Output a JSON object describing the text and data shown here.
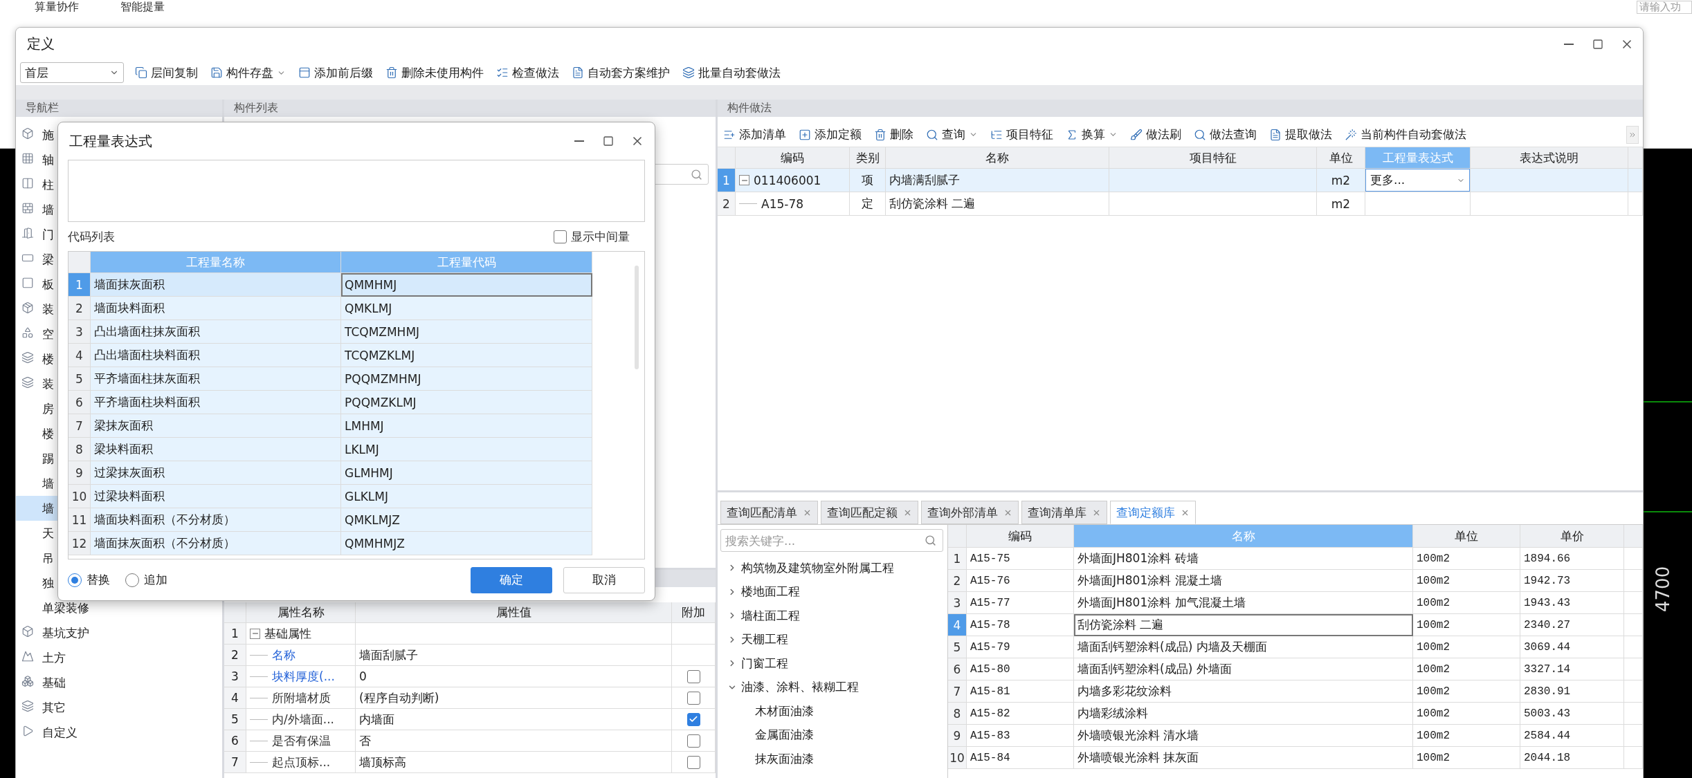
{
  "app": {
    "menu": [
      {
        "label": "算量协作"
      },
      {
        "label": "智能提量"
      }
    ],
    "search": {
      "placeholder": "请输入功"
    },
    "canvas_label": "4700"
  },
  "window": {
    "title": "定义",
    "floor": "首层",
    "toolbar": [
      {
        "label": "层间复制",
        "dropdown": false
      },
      {
        "label": "构件存盘",
        "dropdown": true
      },
      {
        "label": "添加前后缀",
        "dropdown": false
      },
      {
        "label": "删除未使用构件",
        "dropdown": false
      },
      {
        "label": "检查做法",
        "dropdown": false
      },
      {
        "label": "自动套方案维护",
        "dropdown": false
      },
      {
        "label": "批量自动套做法",
        "dropdown": false
      }
    ]
  },
  "nav": {
    "title": "导航栏",
    "items": [
      {
        "label": "施",
        "selected": false
      },
      {
        "label": "轴",
        "selected": false
      },
      {
        "label": "柱",
        "selected": false
      },
      {
        "label": "墙",
        "selected": false
      },
      {
        "label": "门",
        "selected": false
      },
      {
        "label": "梁",
        "selected": false
      },
      {
        "label": "板",
        "selected": false
      },
      {
        "label": "装",
        "selected": false
      },
      {
        "label": "空",
        "selected": false
      },
      {
        "label": "楼",
        "selected": false
      },
      {
        "label": "装",
        "selected": false,
        "children": [
          {
            "label": "房",
            "selected": false
          },
          {
            "label": "楼",
            "selected": false
          },
          {
            "label": "踢",
            "selected": false
          },
          {
            "label": "墙",
            "selected": false
          },
          {
            "label": "墙",
            "selected": true
          },
          {
            "label": "天",
            "selected": false
          },
          {
            "label": "吊",
            "selected": false
          },
          {
            "label": "独",
            "selected": false
          },
          {
            "label": "单梁装修",
            "selected": false
          }
        ]
      },
      {
        "label": "基坑支护",
        "selected": false
      },
      {
        "label": "土方",
        "selected": false
      },
      {
        "label": "基础",
        "selected": false
      },
      {
        "label": "其它",
        "selected": false
      },
      {
        "label": "自定义",
        "selected": false
      }
    ]
  },
  "component_list": {
    "title": "构件列表"
  },
  "properties": {
    "columns": [
      "属性名称",
      "属性值",
      "附加"
    ],
    "rows": [
      {
        "num": "1",
        "kind": "group",
        "name": "基础属性",
        "expanded": true
      },
      {
        "num": "2",
        "kind": "field",
        "name": "名称",
        "value": "墙面刮腻子",
        "public": true
      },
      {
        "num": "3",
        "kind": "option",
        "name": "块料厚度(...",
        "value": "0",
        "public": true,
        "checked": false
      },
      {
        "num": "4",
        "kind": "option",
        "name": "所附墙材质",
        "value": "(程序自动判断)",
        "public": false,
        "checked": false
      },
      {
        "num": "5",
        "kind": "option",
        "name": "内/外墙面...",
        "value": "内墙面",
        "public": false,
        "checked": true
      },
      {
        "num": "6",
        "kind": "option",
        "name": "是否有保温",
        "value": "否",
        "public": false,
        "checked": false
      },
      {
        "num": "7",
        "kind": "option",
        "name": "起点顶标...",
        "value": "墙顶标高",
        "public": false,
        "checked": false
      }
    ]
  },
  "methods": {
    "title": "构件做法",
    "toolbar": [
      {
        "label": "添加清单",
        "dropdown": false
      },
      {
        "label": "添加定额",
        "dropdown": false
      },
      {
        "label": "删除",
        "dropdown": false
      },
      {
        "label": "查询",
        "dropdown": true
      },
      {
        "label": "项目特征",
        "dropdown": false
      },
      {
        "label": "换算",
        "dropdown": true
      },
      {
        "label": "做法刷",
        "dropdown": false
      },
      {
        "label": "做法查询",
        "dropdown": false
      },
      {
        "label": "提取做法",
        "dropdown": false
      },
      {
        "label": "当前构件自动套做法",
        "dropdown": false
      }
    ],
    "columns": [
      {
        "label": "编码",
        "selected": false
      },
      {
        "label": "类别",
        "selected": false
      },
      {
        "label": "名称",
        "selected": false
      },
      {
        "label": "项目特征",
        "selected": false
      },
      {
        "label": "单位",
        "selected": false
      },
      {
        "label": "工程量表达式",
        "selected": true
      },
      {
        "label": "表达式说明",
        "selected": false
      }
    ],
    "rows": [
      {
        "num": "1",
        "code": "011406001",
        "type": "项",
        "name": "内墙满刮腻子",
        "unit": "m2",
        "expression": "更多...",
        "selected": true,
        "expanded": true,
        "children": [
          {
            "num": "2",
            "code": "A15-78",
            "type": "定",
            "name": "刮仿瓷涂料 二遍",
            "unit": "m2",
            "selected": false
          }
        ]
      }
    ]
  },
  "query": {
    "tabs": [
      {
        "label": "查询匹配清单",
        "selected": false
      },
      {
        "label": "查询匹配定额",
        "selected": false
      },
      {
        "label": "查询外部清单",
        "selected": false
      },
      {
        "label": "查询清单库",
        "selected": false
      },
      {
        "label": "查询定额库",
        "selected": true
      }
    ],
    "search": {
      "placeholder": "搜索关键字..."
    },
    "tree": [
      {
        "label": "构筑物及建筑物室外附属工程",
        "expanded": false
      },
      {
        "label": "楼地面工程",
        "expanded": false
      },
      {
        "label": "墙柱面工程",
        "expanded": false
      },
      {
        "label": "天棚工程",
        "expanded": false
      },
      {
        "label": "门窗工程",
        "expanded": false
      },
      {
        "label": "油漆、涂料、裱糊工程",
        "expanded": true,
        "children": [
          {
            "label": "木材面油漆"
          },
          {
            "label": "金属面油漆"
          },
          {
            "label": "抹灰面油漆"
          }
        ]
      }
    ],
    "columns": [
      {
        "label": "编码",
        "selected": false
      },
      {
        "label": "名称",
        "selected": true
      },
      {
        "label": "单位",
        "selected": false
      },
      {
        "label": "单价",
        "selected": false
      }
    ],
    "rows": [
      {
        "num": "1",
        "code": "A15-75",
        "name": "外墙面JH801涂料 砖墙",
        "unit": "100m2",
        "price": "1894.66",
        "selected": false
      },
      {
        "num": "2",
        "code": "A15-76",
        "name": "外墙面JH801涂料 混凝土墙",
        "unit": "100m2",
        "price": "1942.73",
        "selected": false
      },
      {
        "num": "3",
        "code": "A15-77",
        "name": "外墙面JH801涂料 加气混凝土墙",
        "unit": "100m2",
        "price": "1943.43",
        "selected": false
      },
      {
        "num": "4",
        "code": "A15-78",
        "name": "刮仿瓷涂料 二遍",
        "unit": "100m2",
        "price": "2340.27",
        "selected": true
      },
      {
        "num": "5",
        "code": "A15-79",
        "name": "墙面刮钙塑涂料(成品) 内墙及天棚面",
        "unit": "100m2",
        "price": "3069.44",
        "selected": false
      },
      {
        "num": "6",
        "code": "A15-80",
        "name": "墙面刮钙塑涂料(成品) 外墙面",
        "unit": "100m2",
        "price": "3327.14",
        "selected": false
      },
      {
        "num": "7",
        "code": "A15-81",
        "name": "内墙多彩花纹涂料",
        "unit": "100m2",
        "price": "2830.91",
        "selected": false
      },
      {
        "num": "8",
        "code": "A15-82",
        "name": "内墙彩绒涂料",
        "unit": "100m2",
        "price": "5003.43",
        "selected": false
      },
      {
        "num": "9",
        "code": "A15-83",
        "name": "外墙喷银光涂料 清水墙",
        "unit": "100m2",
        "price": "2584.44",
        "selected": false
      },
      {
        "num": "10",
        "code": "A15-84",
        "name": "外墙喷银光涂料 抹灰面",
        "unit": "100m2",
        "price": "2044.18",
        "selected": false
      }
    ]
  },
  "dialog": {
    "title": "工程量表达式",
    "code_list_label": "代码列表",
    "show_intermediate": {
      "label": "显示中间量",
      "checked": false
    },
    "columns": [
      "工程量名称",
      "工程量代码"
    ],
    "rows": [
      {
        "num": "1",
        "name": "墙面抹灰面积",
        "code": "QMMHMJ",
        "selected": true
      },
      {
        "num": "2",
        "name": "墙面块料面积",
        "code": "QMKLMJ",
        "selected": false
      },
      {
        "num": "3",
        "name": "凸出墙面柱抹灰面积",
        "code": "TCQMZMHMJ",
        "selected": false
      },
      {
        "num": "4",
        "name": "凸出墙面柱块料面积",
        "code": "TCQMZKLMJ",
        "selected": false
      },
      {
        "num": "5",
        "name": "平齐墙面柱抹灰面积",
        "code": "PQQMZMHMJ",
        "selected": false
      },
      {
        "num": "6",
        "name": "平齐墙面柱块料面积",
        "code": "PQQMZKLMJ",
        "selected": false
      },
      {
        "num": "7",
        "name": "梁抹灰面积",
        "code": "LMHMJ",
        "selected": false
      },
      {
        "num": "8",
        "name": "梁块料面积",
        "code": "LKLMJ",
        "selected": false
      },
      {
        "num": "9",
        "name": "过梁抹灰面积",
        "code": "GLMHMJ",
        "selected": false
      },
      {
        "num": "10",
        "name": "过梁块料面积",
        "code": "GLKLMJ",
        "selected": false
      },
      {
        "num": "11",
        "name": "墙面块料面积（不分材质）",
        "code": "QMKLMJZ",
        "selected": false
      },
      {
        "num": "12",
        "name": "墙面抹灰面积（不分材质）",
        "code": "QMMHMJZ",
        "selected": false
      }
    ],
    "modes": [
      {
        "label": "替换",
        "selected": true
      },
      {
        "label": "追加",
        "selected": false
      }
    ],
    "buttons": [
      {
        "label": "确定",
        "kind": "primary"
      },
      {
        "label": "取消",
        "kind": "secondary"
      }
    ]
  }
}
